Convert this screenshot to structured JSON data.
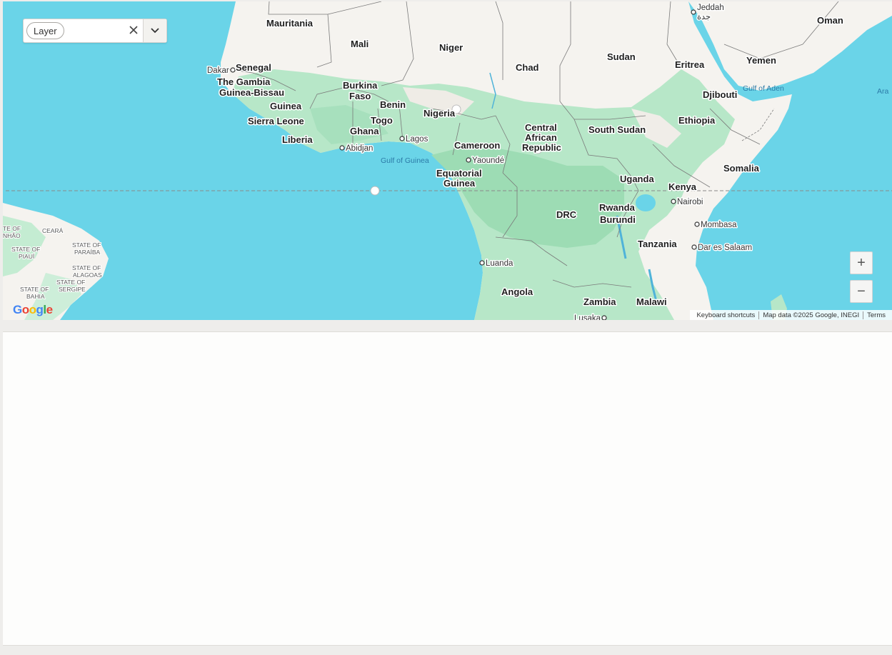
{
  "layer_filter": {
    "chip_label": "Layer"
  },
  "map": {
    "countries": [
      "Mauritania",
      "Mali",
      "Niger",
      "Chad",
      "Sudan",
      "Senegal",
      "The Gambia",
      "Guinea-Bissau",
      "Guinea",
      "Sierra Leone",
      "Liberia",
      "Burkina",
      "Faso",
      "Benin",
      "Togo",
      "Ghana",
      "Nigeria",
      "Cameroon",
      "Central",
      "African",
      "Republic",
      "South Sudan",
      "Ethiopia",
      "Eritrea",
      "Djibouti",
      "Yemen",
      "Oman",
      "Somalia",
      "Uganda",
      "Kenya",
      "Equatorial",
      "Guinea",
      "DRC",
      "Rwanda",
      "Burundi",
      "Tanzania",
      "Angola",
      "Zambia",
      "Malawi"
    ],
    "cities": [
      "Dakar",
      "Abidjan",
      "Lagos",
      "Yaoundé",
      "Nairobi",
      "Mombasa",
      "Dar es Salaam",
      "Luanda",
      "Lusaka",
      "Jeddah"
    ],
    "jeddah_arabic": "جدة",
    "water": [
      "Gulf of Guinea",
      "Gulf of Aden",
      "Ara"
    ],
    "states": [
      "TE OF",
      "NHÃO",
      "CEARÁ",
      "STATE OF",
      "PIAUÍ",
      "STATE OF",
      "PARAÍBA",
      "STATE OF",
      "ALAGOAS",
      "STATE OF",
      "SERGIPE",
      "STATE OF",
      "BAHIA"
    ],
    "zoom_in": "+",
    "zoom_out": "−",
    "logo": "Google",
    "attribution": [
      "Keyboard shortcuts",
      "Map data ©2025 Google, INEGI",
      "Terms"
    ],
    "colors": {
      "water": "#6ad4e8",
      "land": "#f5f3ef",
      "vegetation": "#b4e6c6",
      "dense_vegetation": "#9edcb6",
      "equator": "#8a8a8a"
    }
  }
}
